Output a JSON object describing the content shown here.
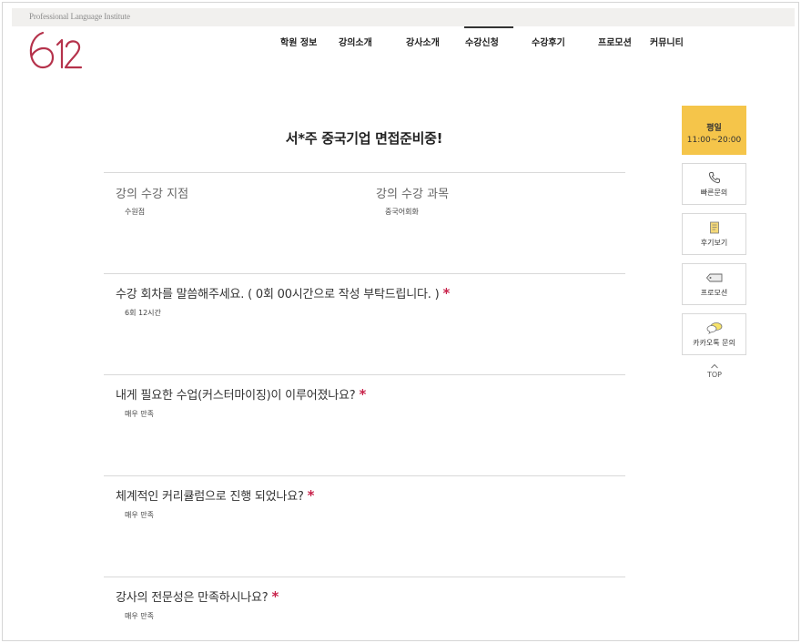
{
  "header": {
    "tagline": "Professional Language Institute",
    "logo_text": "612",
    "brand_color": "#b5324b"
  },
  "nav": {
    "items": [
      {
        "label": "학원 정보"
      },
      {
        "label": "강의소개"
      },
      {
        "label": "강사소개"
      },
      {
        "label": "수강신청",
        "active": true
      },
      {
        "label": "수강후기"
      },
      {
        "label": "프로모션"
      },
      {
        "label": "커뮤니티"
      }
    ]
  },
  "page": {
    "title": "서*주 중국기업 면접준비중!"
  },
  "form": {
    "branch_label": "강의 수강 지점",
    "branch_value": "수원점",
    "course_label": "강의 수강 과목",
    "course_value": "중국어회화",
    "questions": [
      {
        "label": "수강 회차를 말씀해주세요. ( 0회 00시간으로 작성 부탁드립니다. )",
        "required": "*",
        "answer": "6회 12시간"
      },
      {
        "label": "내게 필요한 수업(커스터마이징)이 이루어졌나요?",
        "required": "*",
        "answer": "매우 만족"
      },
      {
        "label": "체계적인 커리큘럼으로 진행 되었나요?",
        "required": "*",
        "answer": "매우 만족"
      },
      {
        "label": "강사의 전문성은 만족하시나요?",
        "required": "*",
        "answer": "매우 만족"
      }
    ]
  },
  "sidebar": {
    "hours_title": "평일",
    "hours_time": "11:00~20:00",
    "hours_color": "#f5c54a",
    "buttons": [
      {
        "label": "빠른문의",
        "icon": "phone-icon"
      },
      {
        "label": "후기보기",
        "icon": "review-icon"
      },
      {
        "label": "프로모션",
        "icon": "tag-icon"
      },
      {
        "label": "카카오톡 문의",
        "icon": "chat-bubble-icon"
      }
    ],
    "top_label": "TOP"
  }
}
